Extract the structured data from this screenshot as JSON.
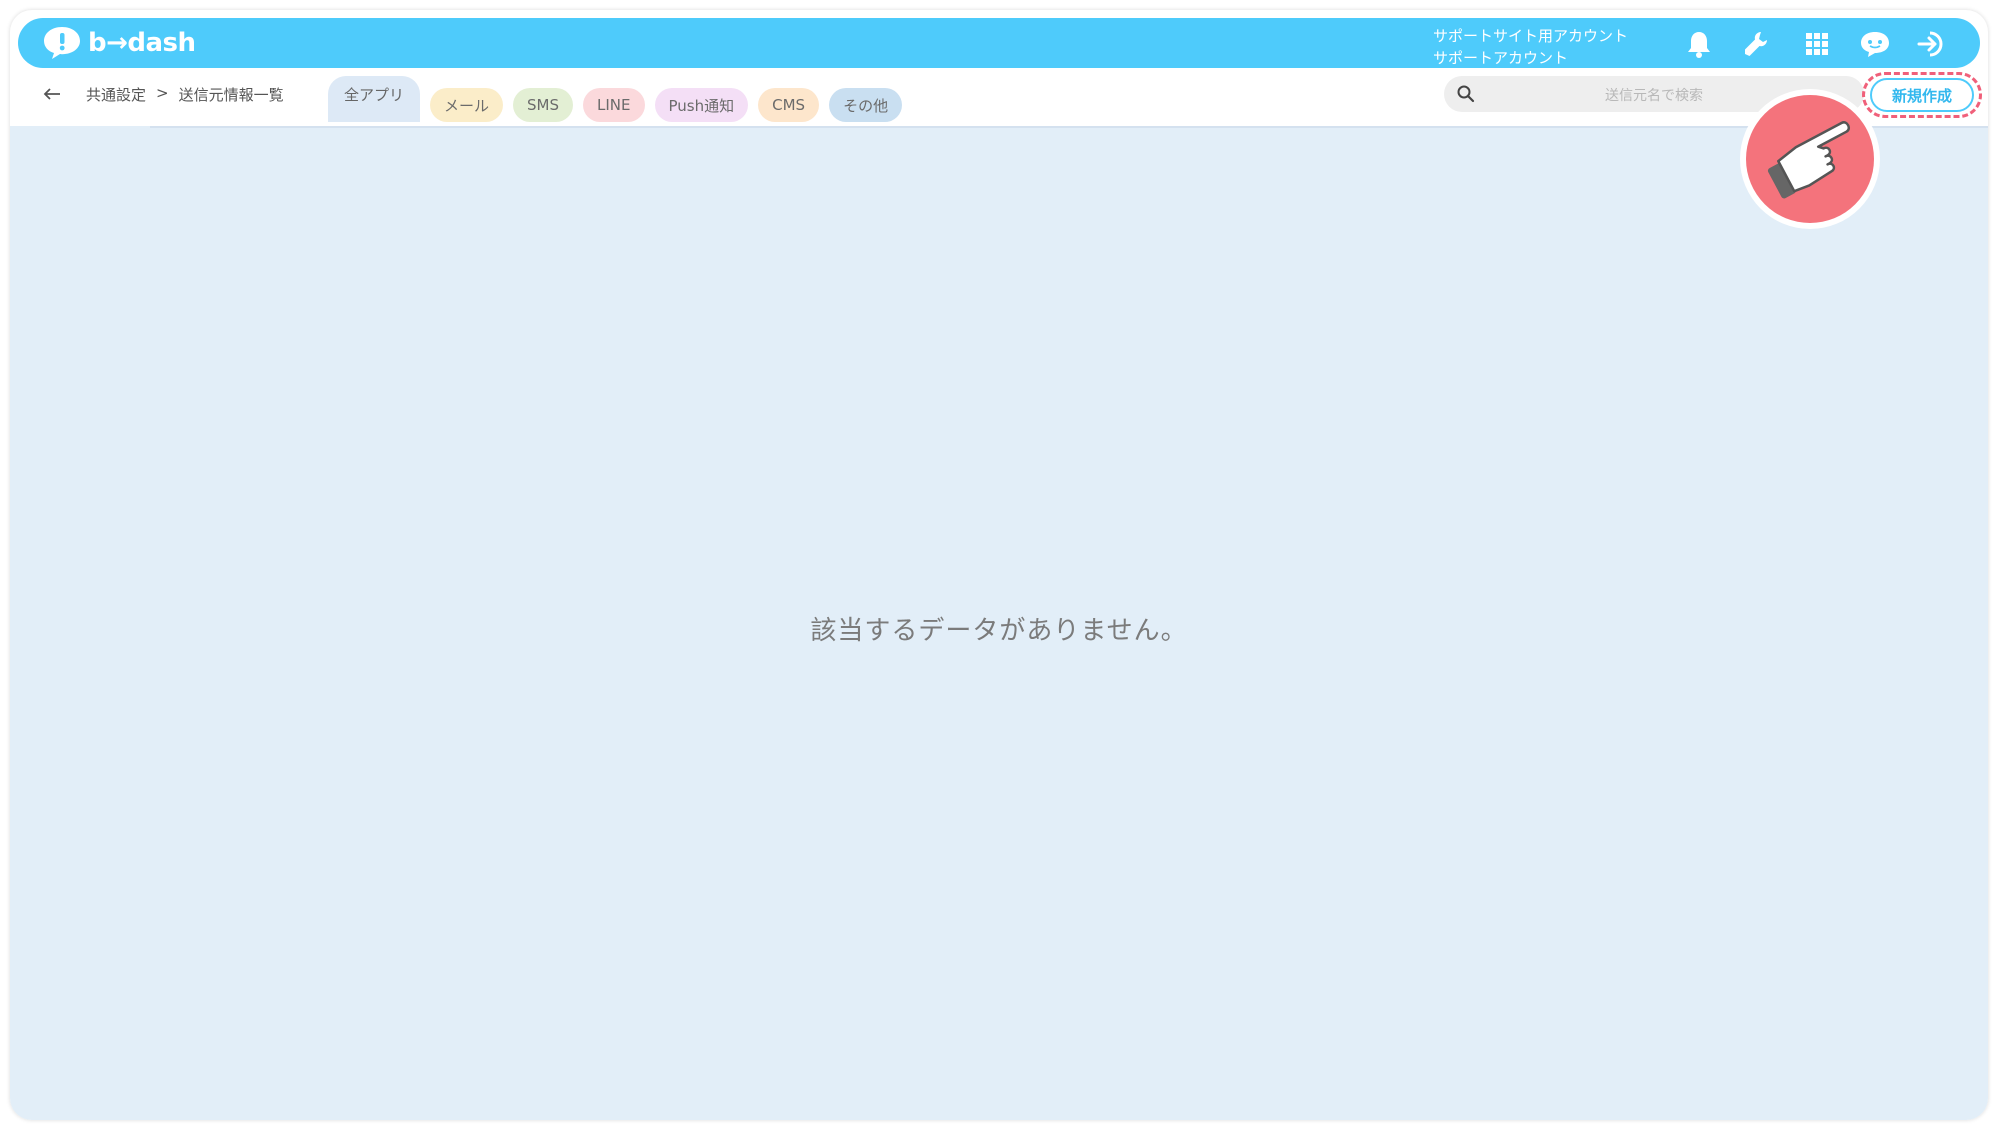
{
  "header": {
    "logo_text": "b→dash",
    "account_line1": "サポートサイト用アカウント",
    "account_line2": "サポートアカウント",
    "icons": [
      "bell-icon",
      "wrench-icon",
      "grid-icon",
      "chatbot-icon",
      "logout-icon"
    ],
    "bar_color": "#4ecbfb"
  },
  "breadcrumb": {
    "items": [
      "共通設定",
      ">",
      "送信元情報一覧"
    ]
  },
  "tabs": [
    {
      "label": "全アプリ",
      "color": "#dde9f6",
      "active": true
    },
    {
      "label": "メール",
      "color": "#fbedc9"
    },
    {
      "label": "SMS",
      "color": "#e3efd4"
    },
    {
      "label": "LINE",
      "color": "#fbd9dc"
    },
    {
      "label": "Push通知",
      "color": "#f4dff6"
    },
    {
      "label": "CMS",
      "color": "#fde6cc"
    },
    {
      "label": "その他",
      "color": "#c9dff1"
    }
  ],
  "search": {
    "placeholder": "送信元名で検索"
  },
  "actions": {
    "new_label": "新規作成",
    "highlight_color": "#f0607a"
  },
  "main": {
    "empty_message": "該当するデータがありません。",
    "background": "#e2eef8"
  }
}
